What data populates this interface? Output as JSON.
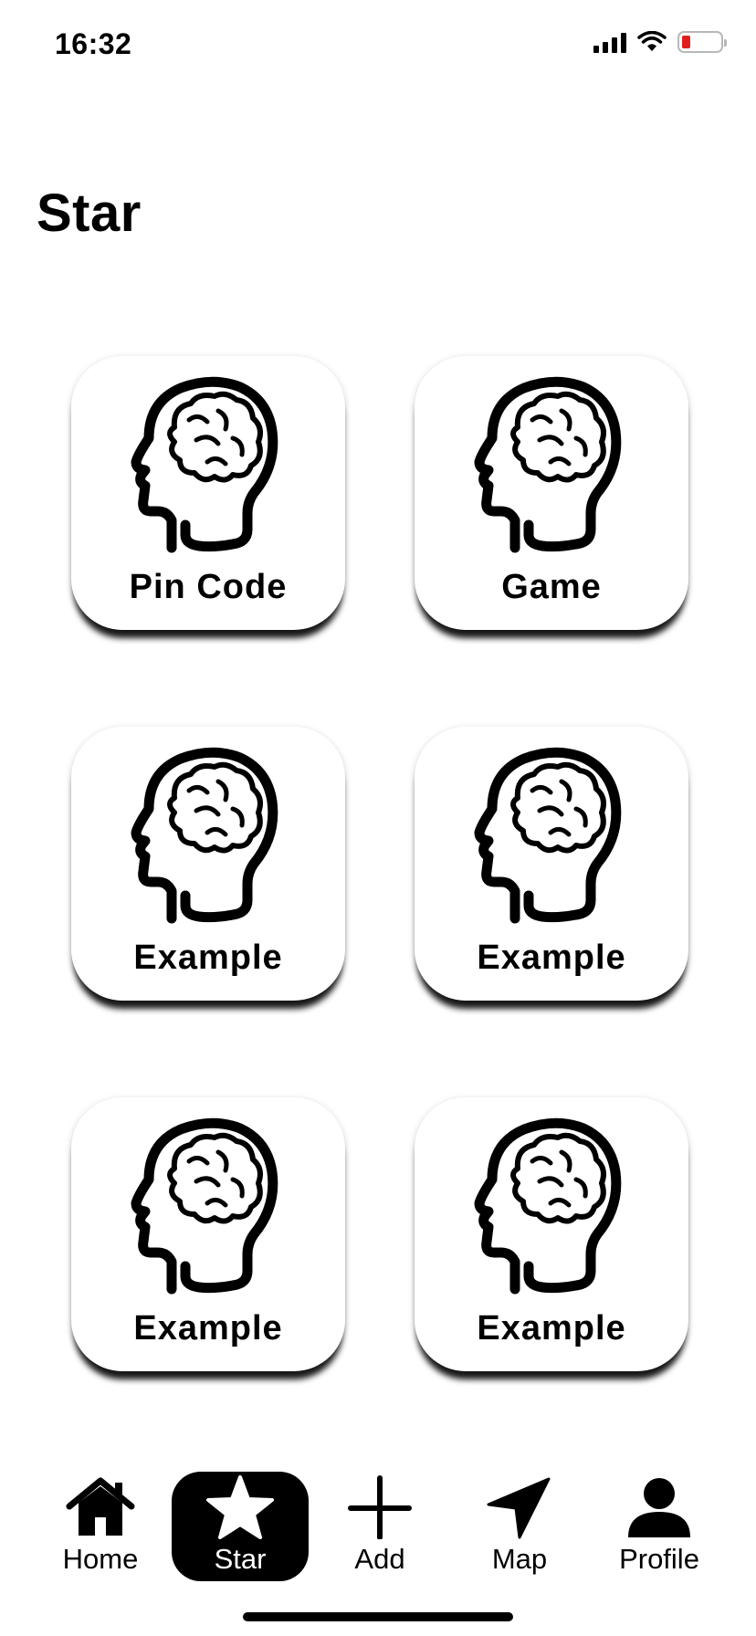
{
  "status": {
    "time": "16:32",
    "battery_color": "#e02020"
  },
  "page": {
    "title": "Star"
  },
  "cards": [
    {
      "label": "Pin Code",
      "icon": "brain-head-icon"
    },
    {
      "label": "Game",
      "icon": "brain-head-icon"
    },
    {
      "label": "Example",
      "icon": "brain-head-icon"
    },
    {
      "label": "Example",
      "icon": "brain-head-icon"
    },
    {
      "label": "Example",
      "icon": "brain-head-icon"
    },
    {
      "label": "Example",
      "icon": "brain-head-icon"
    }
  ],
  "tabs": [
    {
      "label": "Home",
      "icon": "home-icon"
    },
    {
      "label": "Star",
      "icon": "star-icon",
      "active": true
    },
    {
      "label": "Add",
      "icon": "plus-icon"
    },
    {
      "label": "Map",
      "icon": "location-arrow-icon"
    },
    {
      "label": "Profile",
      "icon": "person-icon"
    }
  ]
}
